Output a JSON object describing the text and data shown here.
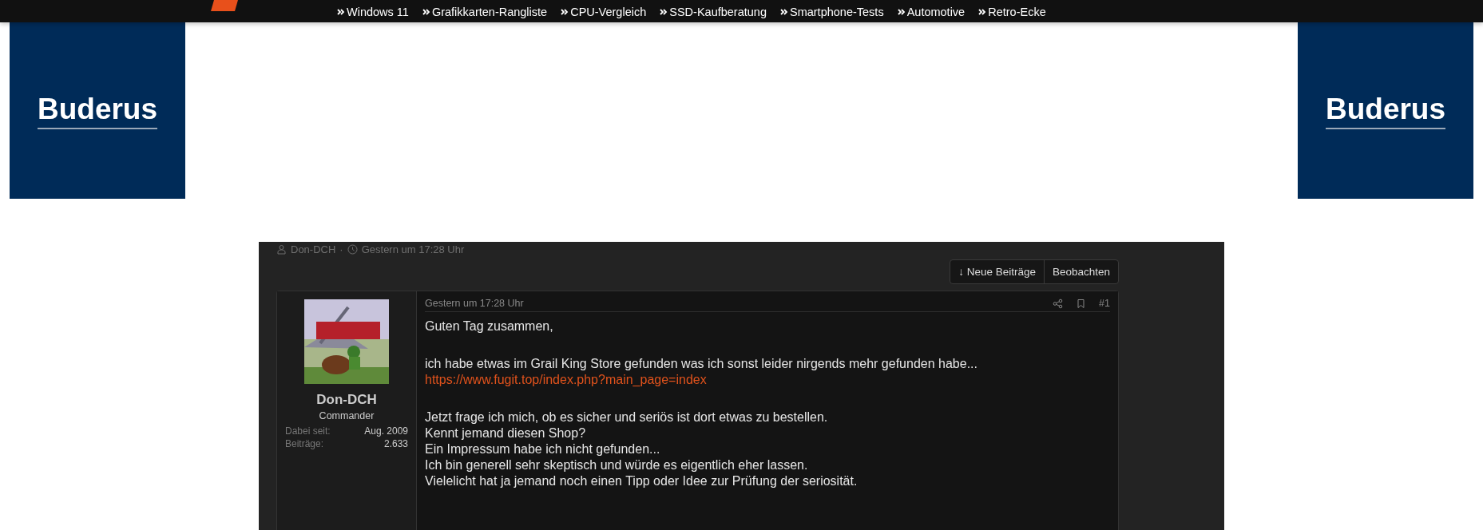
{
  "nav": [
    {
      "label": "Windows 11"
    },
    {
      "label": "Grafikkarten-Rangliste"
    },
    {
      "label": "CPU-Vergleich"
    },
    {
      "label": "SSD-Kaufberatung"
    },
    {
      "label": "Smartphone-Tests"
    },
    {
      "label": "Automotive"
    },
    {
      "label": "Retro-Ecke"
    }
  ],
  "ads": [
    {
      "brand": "Buderus"
    },
    {
      "brand": "Buderus"
    }
  ],
  "thread": {
    "meta": {
      "author": "Don-DCH",
      "separator": "·",
      "time": "Gestern um 17:28 Uhr"
    },
    "buttons": [
      {
        "label": "↓ Neue Beiträge"
      },
      {
        "label": "Beobachten"
      }
    ],
    "post": {
      "user": {
        "name": "Don-DCH",
        "title": "Commander",
        "stats": [
          {
            "label": "Dabei seit:",
            "value": "Aug. 2009"
          },
          {
            "label": "Beiträge:",
            "value": "2.633"
          }
        ]
      },
      "time": "Gestern um 17:28 Uhr",
      "number": "#1",
      "paragraphs": [
        [
          {
            "kind": "text",
            "text": "Guten Tag zusammen,"
          }
        ],
        [
          {
            "kind": "text",
            "text": "ich habe etwas im Grail King Store gefunden was ich sonst leider nirgends mehr gefunden habe..."
          },
          {
            "kind": "link",
            "text": "https://www.fugit.top/index.php?main_page=index"
          }
        ],
        [
          {
            "kind": "text",
            "text": "Jetzt frage ich mich, ob es sicher und seriös ist dort etwas zu bestellen."
          },
          {
            "kind": "text",
            "text": "Kennt jemand diesen Shop?"
          },
          {
            "kind": "text",
            "text": "Ein Impressum habe ich nicht gefunden..."
          },
          {
            "kind": "text",
            "text": "Ich bin generell sehr skeptisch und würde es eigentlich eher lassen."
          },
          {
            "kind": "text",
            "text": "Vielelicht hat ja jemand noch einen Tipp oder Idee zur Prüfung der seriosität."
          }
        ]
      ]
    }
  }
}
